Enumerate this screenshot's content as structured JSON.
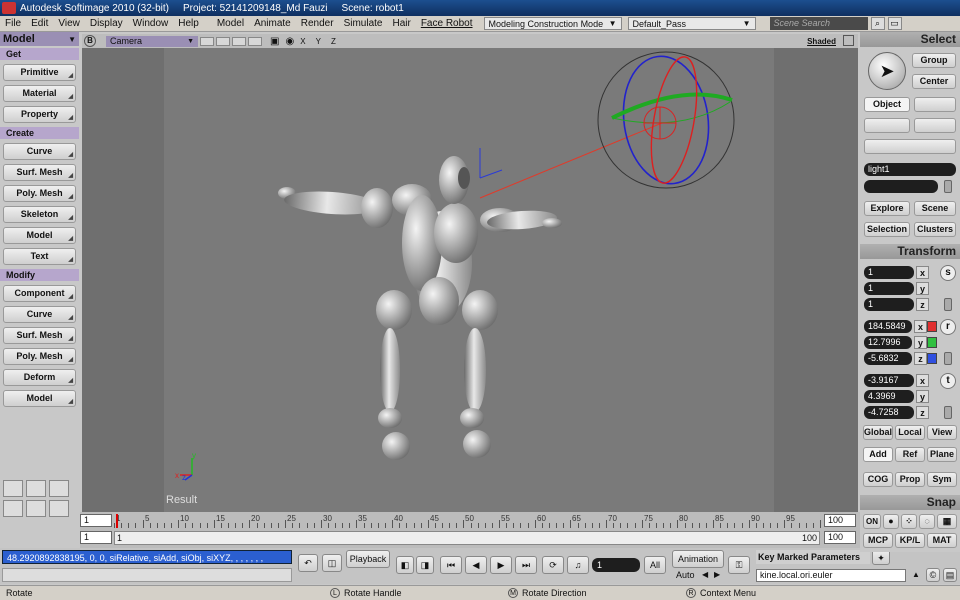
{
  "titlebar": {
    "app": "Autodesk Softimage 2010 (32-bit)",
    "project": "Project: 52141209148_Md Fauzi",
    "scene": "Scene: robot1"
  },
  "menu": {
    "items": [
      "File",
      "Edit",
      "View",
      "Display",
      "Window",
      "Help"
    ],
    "modules": [
      "Model",
      "Animate",
      "Render",
      "Simulate",
      "Hair",
      "Face Robot"
    ],
    "construction_mode": "Modeling Construction Mode",
    "pass": "Default_Pass",
    "search_placeholder": "Scene Search"
  },
  "left_panel": {
    "title": "Model",
    "get_label": "Get",
    "get_items": [
      "Primitive",
      "Material",
      "Property"
    ],
    "create_label": "Create",
    "create_items": [
      "Curve",
      "Surf. Mesh",
      "Poly. Mesh",
      "Skeleton",
      "Model",
      "Text"
    ],
    "modify_label": "Modify",
    "modify_items": [
      "Component",
      "Curve",
      "Surf. Mesh",
      "Poly. Mesh",
      "Deform",
      "Model"
    ]
  },
  "viewport": {
    "mode_badge": "B",
    "camera": "Camera",
    "axes": "X Y Z",
    "shading": "Shaded",
    "result_label": "Result",
    "axis_x": "x",
    "axis_y": "y",
    "axis_z": "z"
  },
  "timeline": {
    "start_top": "1",
    "start_bottom": "1",
    "lower_start": "1",
    "lower_end": "100",
    "end_top": "100",
    "end_bottom": "100",
    "ticks": [
      "1",
      "5",
      "10",
      "15",
      "20",
      "25",
      "30",
      "35",
      "40",
      "45",
      "50",
      "55",
      "60",
      "65",
      "70",
      "75",
      "80",
      "85",
      "90",
      "95"
    ]
  },
  "command": {
    "line": "48.2920892838195, 0, 0, siRelative, siAdd, siObj, siXYZ, , , , , , ,",
    "playback": "Playback",
    "frame": "1",
    "all": "All",
    "animation": "Animation",
    "auto": "Auto",
    "key_marked": "Key Marked Parameters",
    "param_field": "kine.local.ori.euler"
  },
  "status": {
    "left": "Rotate",
    "l": "Rotate Handle",
    "m": "Rotate Direction",
    "r": "Context Menu"
  },
  "right_panel": {
    "select_title": "Select",
    "group": "Group",
    "center": "Center",
    "object": "Object",
    "selected_name": "light1",
    "explore": "Explore",
    "scene": "Scene",
    "selection": "Selection",
    "clusters": "Clusters",
    "transform_title": "Transform",
    "scale": [
      "1",
      "1",
      "1"
    ],
    "rotation": [
      "184.5849",
      "12.7996",
      "-5.6832"
    ],
    "translation": [
      "-3.9167",
      "4.3969",
      "-4.7258"
    ],
    "s_label": "s",
    "r_label": "r",
    "t_label": "t",
    "global": "Global",
    "local": "Local",
    "view": "View",
    "add": "Add",
    "ref": "Ref",
    "plane": "Plane",
    "cog": "COG",
    "prop": "Prop",
    "sym": "Sym",
    "snap_title": "Snap",
    "on": "ON",
    "mcp": "MCP",
    "kpl": "KP/L",
    "mat": "MAT"
  },
  "colors": {
    "accent_purple": "#9a8fb4",
    "viewport_bg": "#7a7a7a",
    "cmd_blue": "#2b5fd0",
    "field_dark": "#1e1e1e"
  }
}
